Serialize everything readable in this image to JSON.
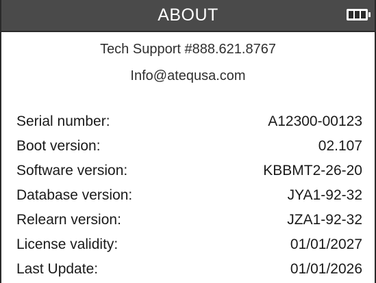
{
  "header": {
    "title": "ABOUT",
    "battery_icon": "battery-full-icon",
    "battery_level": 1.0
  },
  "contact": {
    "support": "Tech Support #888.621.8767",
    "email": "Info@atequsa.com"
  },
  "info": {
    "rows": [
      {
        "label": "Serial number:",
        "value": "A12300-00123"
      },
      {
        "label": "Boot version:",
        "value": "02.107"
      },
      {
        "label": "Software version:",
        "value": "KBBMT2-26-20"
      },
      {
        "label": "Database version:",
        "value": "JYA1-92-32"
      },
      {
        "label": "Relearn version:",
        "value": "JZA1-92-32"
      },
      {
        "label": "License validity:",
        "value": "01/01/2027"
      },
      {
        "label": "Last Update:",
        "value": "01/01/2026"
      }
    ]
  },
  "colors": {
    "header_bg": "#4a4a4a",
    "header_text": "#ffffff",
    "body_bg": "#ffffff",
    "text": "#1a1a1a"
  }
}
